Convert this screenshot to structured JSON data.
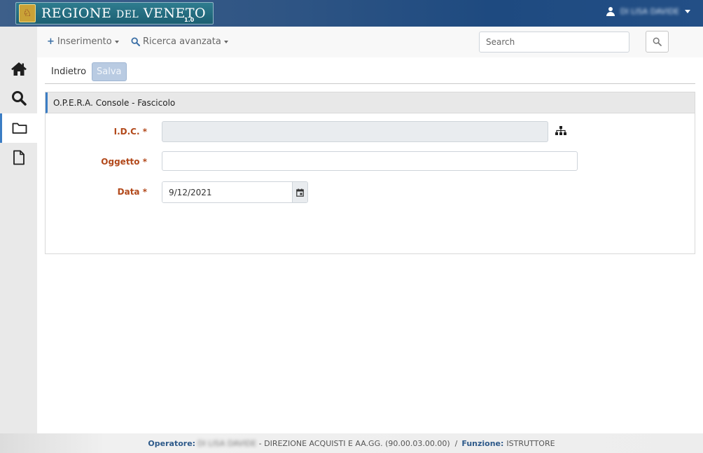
{
  "header": {
    "logo_text_main": "REGIONE",
    "logo_text_small": "DEL",
    "logo_text_tail": "VENETO",
    "version": "1.0",
    "user_name": "DI LISA DAVIDE"
  },
  "sidebar": {
    "items": [
      {
        "icon": "home-icon"
      },
      {
        "icon": "search-icon"
      },
      {
        "icon": "folder-icon"
      },
      {
        "icon": "file-icon"
      }
    ]
  },
  "toolbar": {
    "insert_label": "Inserimento",
    "advanced_search_label": "Ricerca avanzata",
    "search_placeholder": "Search"
  },
  "actions": {
    "back_label": "Indietro",
    "save_label": "Salva"
  },
  "panel": {
    "title": "O.P.E.R.A. Console - Fascicolo",
    "fields": {
      "idc_label": "I.D.C. *",
      "idc_value": "",
      "oggetto_label": "Oggetto *",
      "oggetto_value": "",
      "data_label": "Data *",
      "data_value": "9/12/2021"
    }
  },
  "footer": {
    "operator_label": "Operatore:",
    "operator_name": "DI LISA DAVIDE",
    "department": " - DIREZIONE ACQUISTI E AA.GG. (90.00.03.00.00)  /",
    "function_label": "Funzione:",
    "function_value": "ISTRUTTORE"
  },
  "colors": {
    "accent": "#3b7dc4",
    "label_required": "#b2491b",
    "header_bg": "#1e4a80"
  }
}
